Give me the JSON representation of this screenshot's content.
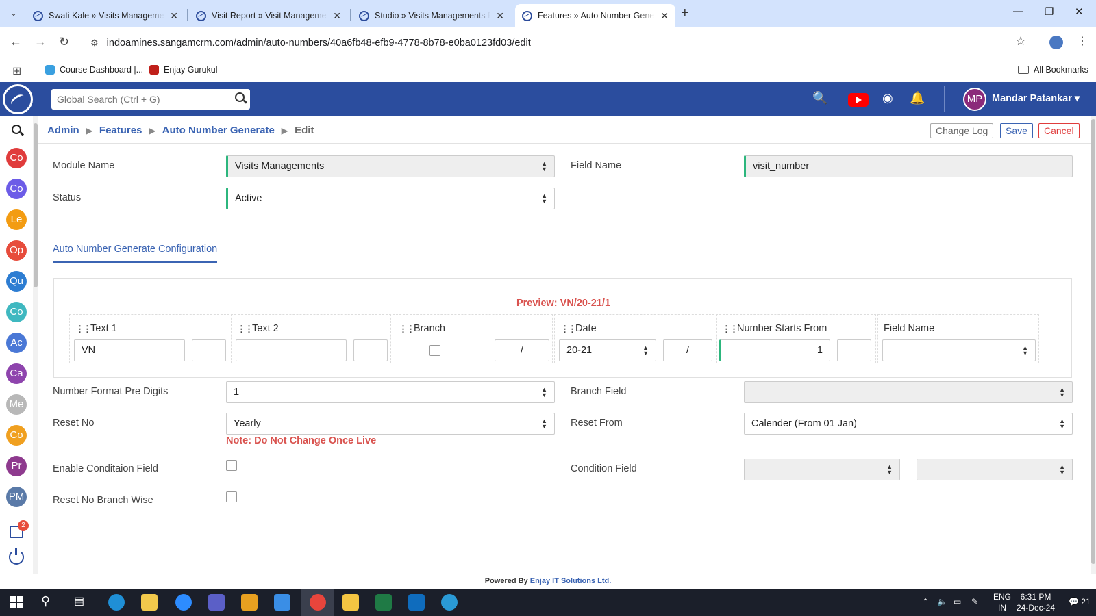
{
  "browser": {
    "tabs": [
      {
        "title": "Swati Kale » Visits Management",
        "active": false
      },
      {
        "title": "Visit Report » Visit Management",
        "active": false
      },
      {
        "title": "Studio » Visits Managements Fi",
        "active": false
      },
      {
        "title": "Features » Auto Number Gener",
        "active": true
      }
    ],
    "url": "indoamines.sangamcrm.com/admin/auto-numbers/40a6fb48-efb9-4778-8b78-e0ba0123fd03/edit",
    "bookmarks": [
      "Course Dashboard |...",
      "Enjay Gurukul"
    ],
    "all_bookmarks": "All Bookmarks"
  },
  "header": {
    "search_placeholder": "Global Search (Ctrl + G)",
    "user_initials": "MP",
    "user_name": "Mandar Patankar",
    "brand_color": "#2b4d9e"
  },
  "sidebar": {
    "items": [
      {
        "label": "Co",
        "color": "#e03c3c"
      },
      {
        "label": "Co",
        "color": "#6c5ce7"
      },
      {
        "label": "Le",
        "color": "#f39c12"
      },
      {
        "label": "Op",
        "color": "#e74c3c"
      },
      {
        "label": "Qu",
        "color": "#2d7dd2"
      },
      {
        "label": "Co",
        "color": "#3fb8c0"
      },
      {
        "label": "Ac",
        "color": "#4a78d6"
      },
      {
        "label": "Ca",
        "color": "#8e44ad"
      },
      {
        "label": "Me",
        "color": "#b8b8b8"
      },
      {
        "label": "Co",
        "color": "#f0a020"
      },
      {
        "label": "Pr",
        "color": "#8e3a8e"
      },
      {
        "label": "PM",
        "color": "#5a7aa8"
      }
    ],
    "notification_count": "2"
  },
  "breadcrumb": {
    "admin": "Admin",
    "features": "Features",
    "auto_number": "Auto Number Generate",
    "current": "Edit"
  },
  "actions": {
    "change_log": "Change Log",
    "save": "Save",
    "cancel": "Cancel"
  },
  "form": {
    "module_name_label": "Module Name",
    "module_name_value": "Visits Managements",
    "field_name_label": "Field Name",
    "field_name_value": "visit_number",
    "status_label": "Status",
    "status_value": "Active",
    "config_tab": "Auto Number Generate Configuration",
    "preview": "Preview: VN/20-21/1",
    "segments": {
      "text1": {
        "title": "Text 1",
        "value": "VN",
        "separator": ""
      },
      "text2": {
        "title": "Text 2",
        "value": "",
        "separator": ""
      },
      "branch": {
        "title": "Branch",
        "separator": "/"
      },
      "date": {
        "title": "Date",
        "value": "20-21",
        "separator": "/"
      },
      "number": {
        "title": "Number Starts From",
        "value": "1",
        "separator": ""
      },
      "field_name": {
        "title": "Field Name",
        "value": ""
      }
    },
    "pre_digits_label": "Number Format Pre Digits",
    "pre_digits_value": "1",
    "branch_field_label": "Branch Field",
    "branch_field_value": "",
    "reset_no_label": "Reset No",
    "reset_no_value": "Yearly",
    "reset_from_label": "Reset From",
    "reset_from_value": "Calender (From 01 Jan)",
    "note": "Note: Do Not Change Once Live",
    "enable_condition_label": "Enable Conditaion Field",
    "condition_field_label": "Condition Field",
    "reset_branch_wise_label": "Reset No Branch Wise"
  },
  "footer": {
    "powered_by": "Powered By ",
    "company": "Enjay IT Solutions Ltd."
  },
  "taskbar": {
    "lang_top": "ENG",
    "lang_bottom": "IN",
    "time": "6:31 PM",
    "date": "24-Dec-24",
    "notifications": "21"
  }
}
